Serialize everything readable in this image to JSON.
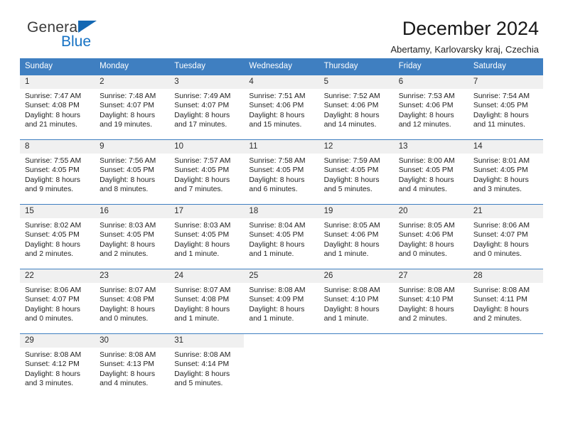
{
  "brand": {
    "word1": "General",
    "word2": "Blue",
    "triangle_icon": "triangle-logo-icon",
    "color_dark": "#3b3b3b",
    "color_blue": "#1672c4"
  },
  "header": {
    "title": "December 2024",
    "subtitle": "Abertamy, Karlovarsky kraj, Czechia"
  },
  "theme": {
    "header_blue": "#3f7fc1",
    "daynum_bg": "#f0f0f0",
    "text": "#1f1f1f"
  },
  "calendar": {
    "weekday_headers": [
      "Sunday",
      "Monday",
      "Tuesday",
      "Wednesday",
      "Thursday",
      "Friday",
      "Saturday"
    ],
    "weeks": [
      [
        {
          "day": "1",
          "sunrise": "Sunrise: 7:47 AM",
          "sunset": "Sunset: 4:08 PM",
          "daylight_line1": "Daylight: 8 hours",
          "daylight_line2": "and 21 minutes."
        },
        {
          "day": "2",
          "sunrise": "Sunrise: 7:48 AM",
          "sunset": "Sunset: 4:07 PM",
          "daylight_line1": "Daylight: 8 hours",
          "daylight_line2": "and 19 minutes."
        },
        {
          "day": "3",
          "sunrise": "Sunrise: 7:49 AM",
          "sunset": "Sunset: 4:07 PM",
          "daylight_line1": "Daylight: 8 hours",
          "daylight_line2": "and 17 minutes."
        },
        {
          "day": "4",
          "sunrise": "Sunrise: 7:51 AM",
          "sunset": "Sunset: 4:06 PM",
          "daylight_line1": "Daylight: 8 hours",
          "daylight_line2": "and 15 minutes."
        },
        {
          "day": "5",
          "sunrise": "Sunrise: 7:52 AM",
          "sunset": "Sunset: 4:06 PM",
          "daylight_line1": "Daylight: 8 hours",
          "daylight_line2": "and 14 minutes."
        },
        {
          "day": "6",
          "sunrise": "Sunrise: 7:53 AM",
          "sunset": "Sunset: 4:06 PM",
          "daylight_line1": "Daylight: 8 hours",
          "daylight_line2": "and 12 minutes."
        },
        {
          "day": "7",
          "sunrise": "Sunrise: 7:54 AM",
          "sunset": "Sunset: 4:05 PM",
          "daylight_line1": "Daylight: 8 hours",
          "daylight_line2": "and 11 minutes."
        }
      ],
      [
        {
          "day": "8",
          "sunrise": "Sunrise: 7:55 AM",
          "sunset": "Sunset: 4:05 PM",
          "daylight_line1": "Daylight: 8 hours",
          "daylight_line2": "and 9 minutes."
        },
        {
          "day": "9",
          "sunrise": "Sunrise: 7:56 AM",
          "sunset": "Sunset: 4:05 PM",
          "daylight_line1": "Daylight: 8 hours",
          "daylight_line2": "and 8 minutes."
        },
        {
          "day": "10",
          "sunrise": "Sunrise: 7:57 AM",
          "sunset": "Sunset: 4:05 PM",
          "daylight_line1": "Daylight: 8 hours",
          "daylight_line2": "and 7 minutes."
        },
        {
          "day": "11",
          "sunrise": "Sunrise: 7:58 AM",
          "sunset": "Sunset: 4:05 PM",
          "daylight_line1": "Daylight: 8 hours",
          "daylight_line2": "and 6 minutes."
        },
        {
          "day": "12",
          "sunrise": "Sunrise: 7:59 AM",
          "sunset": "Sunset: 4:05 PM",
          "daylight_line1": "Daylight: 8 hours",
          "daylight_line2": "and 5 minutes."
        },
        {
          "day": "13",
          "sunrise": "Sunrise: 8:00 AM",
          "sunset": "Sunset: 4:05 PM",
          "daylight_line1": "Daylight: 8 hours",
          "daylight_line2": "and 4 minutes."
        },
        {
          "day": "14",
          "sunrise": "Sunrise: 8:01 AM",
          "sunset": "Sunset: 4:05 PM",
          "daylight_line1": "Daylight: 8 hours",
          "daylight_line2": "and 3 minutes."
        }
      ],
      [
        {
          "day": "15",
          "sunrise": "Sunrise: 8:02 AM",
          "sunset": "Sunset: 4:05 PM",
          "daylight_line1": "Daylight: 8 hours",
          "daylight_line2": "and 2 minutes."
        },
        {
          "day": "16",
          "sunrise": "Sunrise: 8:03 AM",
          "sunset": "Sunset: 4:05 PM",
          "daylight_line1": "Daylight: 8 hours",
          "daylight_line2": "and 2 minutes."
        },
        {
          "day": "17",
          "sunrise": "Sunrise: 8:03 AM",
          "sunset": "Sunset: 4:05 PM",
          "daylight_line1": "Daylight: 8 hours",
          "daylight_line2": "and 1 minute."
        },
        {
          "day": "18",
          "sunrise": "Sunrise: 8:04 AM",
          "sunset": "Sunset: 4:05 PM",
          "daylight_line1": "Daylight: 8 hours",
          "daylight_line2": "and 1 minute."
        },
        {
          "day": "19",
          "sunrise": "Sunrise: 8:05 AM",
          "sunset": "Sunset: 4:06 PM",
          "daylight_line1": "Daylight: 8 hours",
          "daylight_line2": "and 1 minute."
        },
        {
          "day": "20",
          "sunrise": "Sunrise: 8:05 AM",
          "sunset": "Sunset: 4:06 PM",
          "daylight_line1": "Daylight: 8 hours",
          "daylight_line2": "and 0 minutes."
        },
        {
          "day": "21",
          "sunrise": "Sunrise: 8:06 AM",
          "sunset": "Sunset: 4:07 PM",
          "daylight_line1": "Daylight: 8 hours",
          "daylight_line2": "and 0 minutes."
        }
      ],
      [
        {
          "day": "22",
          "sunrise": "Sunrise: 8:06 AM",
          "sunset": "Sunset: 4:07 PM",
          "daylight_line1": "Daylight: 8 hours",
          "daylight_line2": "and 0 minutes."
        },
        {
          "day": "23",
          "sunrise": "Sunrise: 8:07 AM",
          "sunset": "Sunset: 4:08 PM",
          "daylight_line1": "Daylight: 8 hours",
          "daylight_line2": "and 0 minutes."
        },
        {
          "day": "24",
          "sunrise": "Sunrise: 8:07 AM",
          "sunset": "Sunset: 4:08 PM",
          "daylight_line1": "Daylight: 8 hours",
          "daylight_line2": "and 1 minute."
        },
        {
          "day": "25",
          "sunrise": "Sunrise: 8:08 AM",
          "sunset": "Sunset: 4:09 PM",
          "daylight_line1": "Daylight: 8 hours",
          "daylight_line2": "and 1 minute."
        },
        {
          "day": "26",
          "sunrise": "Sunrise: 8:08 AM",
          "sunset": "Sunset: 4:10 PM",
          "daylight_line1": "Daylight: 8 hours",
          "daylight_line2": "and 1 minute."
        },
        {
          "day": "27",
          "sunrise": "Sunrise: 8:08 AM",
          "sunset": "Sunset: 4:10 PM",
          "daylight_line1": "Daylight: 8 hours",
          "daylight_line2": "and 2 minutes."
        },
        {
          "day": "28",
          "sunrise": "Sunrise: 8:08 AM",
          "sunset": "Sunset: 4:11 PM",
          "daylight_line1": "Daylight: 8 hours",
          "daylight_line2": "and 2 minutes."
        }
      ],
      [
        {
          "day": "29",
          "sunrise": "Sunrise: 8:08 AM",
          "sunset": "Sunset: 4:12 PM",
          "daylight_line1": "Daylight: 8 hours",
          "daylight_line2": "and 3 minutes."
        },
        {
          "day": "30",
          "sunrise": "Sunrise: 8:08 AM",
          "sunset": "Sunset: 4:13 PM",
          "daylight_line1": "Daylight: 8 hours",
          "daylight_line2": "and 4 minutes."
        },
        {
          "day": "31",
          "sunrise": "Sunrise: 8:08 AM",
          "sunset": "Sunset: 4:14 PM",
          "daylight_line1": "Daylight: 8 hours",
          "daylight_line2": "and 5 minutes."
        },
        {
          "day": "",
          "sunrise": "",
          "sunset": "",
          "daylight_line1": "",
          "daylight_line2": ""
        },
        {
          "day": "",
          "sunrise": "",
          "sunset": "",
          "daylight_line1": "",
          "daylight_line2": ""
        },
        {
          "day": "",
          "sunrise": "",
          "sunset": "",
          "daylight_line1": "",
          "daylight_line2": ""
        },
        {
          "day": "",
          "sunrise": "",
          "sunset": "",
          "daylight_line1": "",
          "daylight_line2": ""
        }
      ]
    ]
  }
}
